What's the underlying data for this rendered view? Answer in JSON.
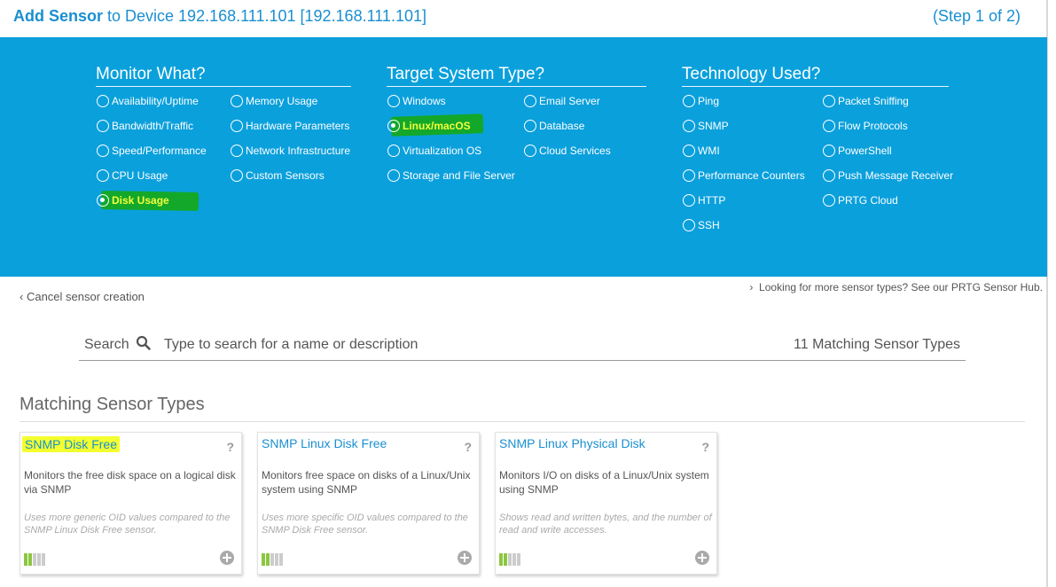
{
  "header": {
    "title_bold": "Add Sensor",
    "title_rest": " to Device 192.168.111.101 [192.168.111.101]",
    "step": "(Step 1 of 2)"
  },
  "monitor": {
    "heading": "Monitor What?",
    "col1": [
      "Availability/Uptime",
      "Bandwidth/Traffic",
      "Speed/Performance",
      "CPU Usage",
      "Disk Usage"
    ],
    "col2": [
      "Memory Usage",
      "Hardware Parameters",
      "Network Infrastructure",
      "Custom Sensors"
    ],
    "selected": "Disk Usage"
  },
  "target": {
    "heading": "Target System Type?",
    "col1": [
      "Windows",
      "Linux/macOS",
      "Virtualization OS",
      "Storage and File Server"
    ],
    "col2": [
      "Email Server",
      "Database",
      "Cloud Services"
    ],
    "selected": "Linux/macOS"
  },
  "technology": {
    "heading": "Technology Used?",
    "col1": [
      "Ping",
      "SNMP",
      "WMI",
      "Performance Counters",
      "HTTP",
      "SSH"
    ],
    "col2": [
      "Packet Sniffing",
      "Flow Protocols",
      "PowerShell",
      "Push Message Receiver",
      "PRTG Cloud"
    ]
  },
  "links": {
    "cancel": "Cancel sensor creation",
    "hub": "Looking for more sensor types? See our PRTG Sensor Hub."
  },
  "search": {
    "label": "Search",
    "placeholder": "Type to search for a name or description",
    "count": "11  Matching Sensor Types"
  },
  "results": {
    "title": "Matching Sensor Types",
    "cards": [
      {
        "name": "SNMP Disk Free",
        "description": "Monitors the free disk space on a logical disk via SNMP",
        "note": "Uses more generic OID values compared to the SNMP Linux Disk Free sensor.",
        "level": 0.4
      },
      {
        "name": "SNMP Linux Disk Free",
        "description": "Monitors free space on disks of a Linux/Unix system using SNMP",
        "note": "Uses more specific OID values compared to the SNMP Disk Free sensor.",
        "level": 0.4
      },
      {
        "name": "SNMP Linux Physical Disk",
        "description": "Monitors I/O on disks of a Linux/Unix system using SNMP",
        "note": "Shows read and written bytes, and the number of read and write accesses.",
        "level": 0.4
      }
    ]
  }
}
